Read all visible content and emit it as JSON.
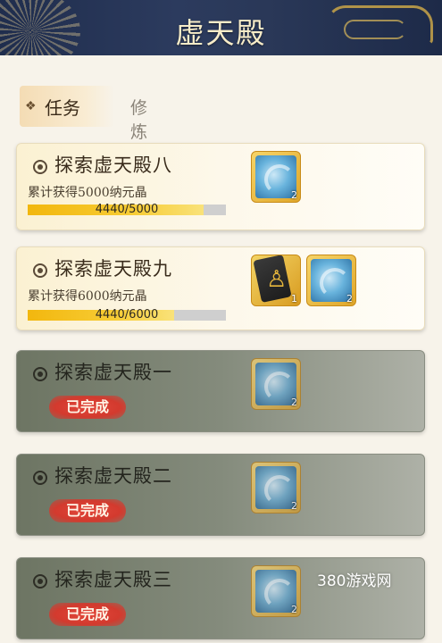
{
  "header": {
    "title": "虚天殿"
  },
  "tabs": [
    {
      "label": "任务",
      "active": true
    },
    {
      "label": "修炼",
      "active": false
    }
  ],
  "tasks": [
    {
      "name": "探索虚天殿八",
      "desc": "累计获得5000纳元晶",
      "progress_text": "4440/5000",
      "progress": 0.888,
      "rewards": [
        {
          "icon": "swirl-token",
          "qty": "2"
        }
      ]
    },
    {
      "name": "探索虚天殿九",
      "desc": "累计获得6000纳元晶",
      "progress_text": "4440/6000",
      "progress": 0.74,
      "rewards": [
        {
          "icon": "skill-book",
          "qty": "1"
        },
        {
          "icon": "swirl-token",
          "qty": "2"
        }
      ]
    },
    {
      "name": "探索虚天殿一",
      "status": "已完成",
      "rewards": [
        {
          "icon": "swirl-token",
          "qty": "2"
        }
      ]
    },
    {
      "name": "探索虚天殿二",
      "status": "已完成",
      "rewards": [
        {
          "icon": "swirl-token",
          "qty": "2"
        }
      ]
    },
    {
      "name": "探索虚天殿三",
      "status": "已完成",
      "rewards": [
        {
          "icon": "swirl-token",
          "qty": "2"
        }
      ]
    }
  ],
  "watermark": "380游戏网",
  "colors": {
    "header_bg": "#2c3b5e",
    "progress_fill": "#f2b70e",
    "done_badge": "#d33a2e",
    "done_card": "#848b7c"
  }
}
